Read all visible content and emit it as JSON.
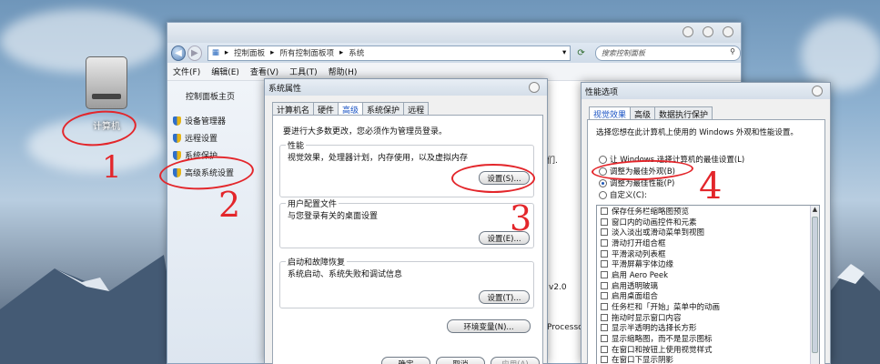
{
  "desktop": {
    "icon_label": "计算机"
  },
  "explorer": {
    "breadcrumb": [
      "控制面板",
      "所有控制面板项",
      "系统"
    ],
    "search_placeholder": "搜索控制面板",
    "menu": [
      "文件(F)",
      "编辑(E)",
      "查看(V)",
      "工具(T)",
      "帮助(H)"
    ],
    "left_home": "控制面板主页",
    "left_links": [
      "设备管理器",
      "远程设置",
      "系统保护",
      "高级系统设置"
    ],
    "bg_text": [
      "们.",
      "v2.0",
      "Processo"
    ]
  },
  "sysprops": {
    "title": "系统属性",
    "tabs": [
      "计算机名",
      "硬件",
      "高级",
      "系统保护",
      "远程"
    ],
    "active_tab": 2,
    "admin_note": "要进行大多数更改，您必须作为管理员登录。",
    "groups": [
      {
        "legend": "性能",
        "desc": "视觉效果，处理器计划，内存使用，以及虚拟内存",
        "button": "设置(S)..."
      },
      {
        "legend": "用户配置文件",
        "desc": "与您登录有关的桌面设置",
        "button": "设置(E)..."
      },
      {
        "legend": "启动和故障恢复",
        "desc": "系统启动、系统失败和调试信息",
        "button": "设置(T)..."
      }
    ],
    "env_button": "环境变量(N)...",
    "bottom_buttons": [
      "确定",
      "取消",
      "应用(A)"
    ]
  },
  "perfopts": {
    "title": "性能选项",
    "tabs": [
      "视觉效果",
      "高级",
      "数据执行保护"
    ],
    "active_tab": 0,
    "desc": "选择您想在此计算机上使用的 Windows 外观和性能设置。",
    "radios": [
      "让 Windows 选择计算机的最佳设置(L)",
      "调整为最佳外观(B)",
      "调整为最佳性能(P)",
      "自定义(C):"
    ],
    "selected_radio": 2,
    "items": [
      "保存任务栏缩略图预览",
      "窗口内的动画控件和元素",
      "淡入淡出或滑动菜单到视图",
      "滑动打开组合框",
      "平滑滚动列表框",
      "平滑屏幕字体边缘",
      "启用 Aero Peek",
      "启用透明玻璃",
      "启用桌面组合",
      "任务栏和「开始」菜单中的动画",
      "拖动时显示窗口内容",
      "显示半透明的选择长方形",
      "显示缩略图，而不是显示图标",
      "在窗口和按钮上使用视觉样式",
      "在窗口下显示阴影"
    ]
  },
  "annotations": [
    "1",
    "2",
    "3",
    "4"
  ]
}
